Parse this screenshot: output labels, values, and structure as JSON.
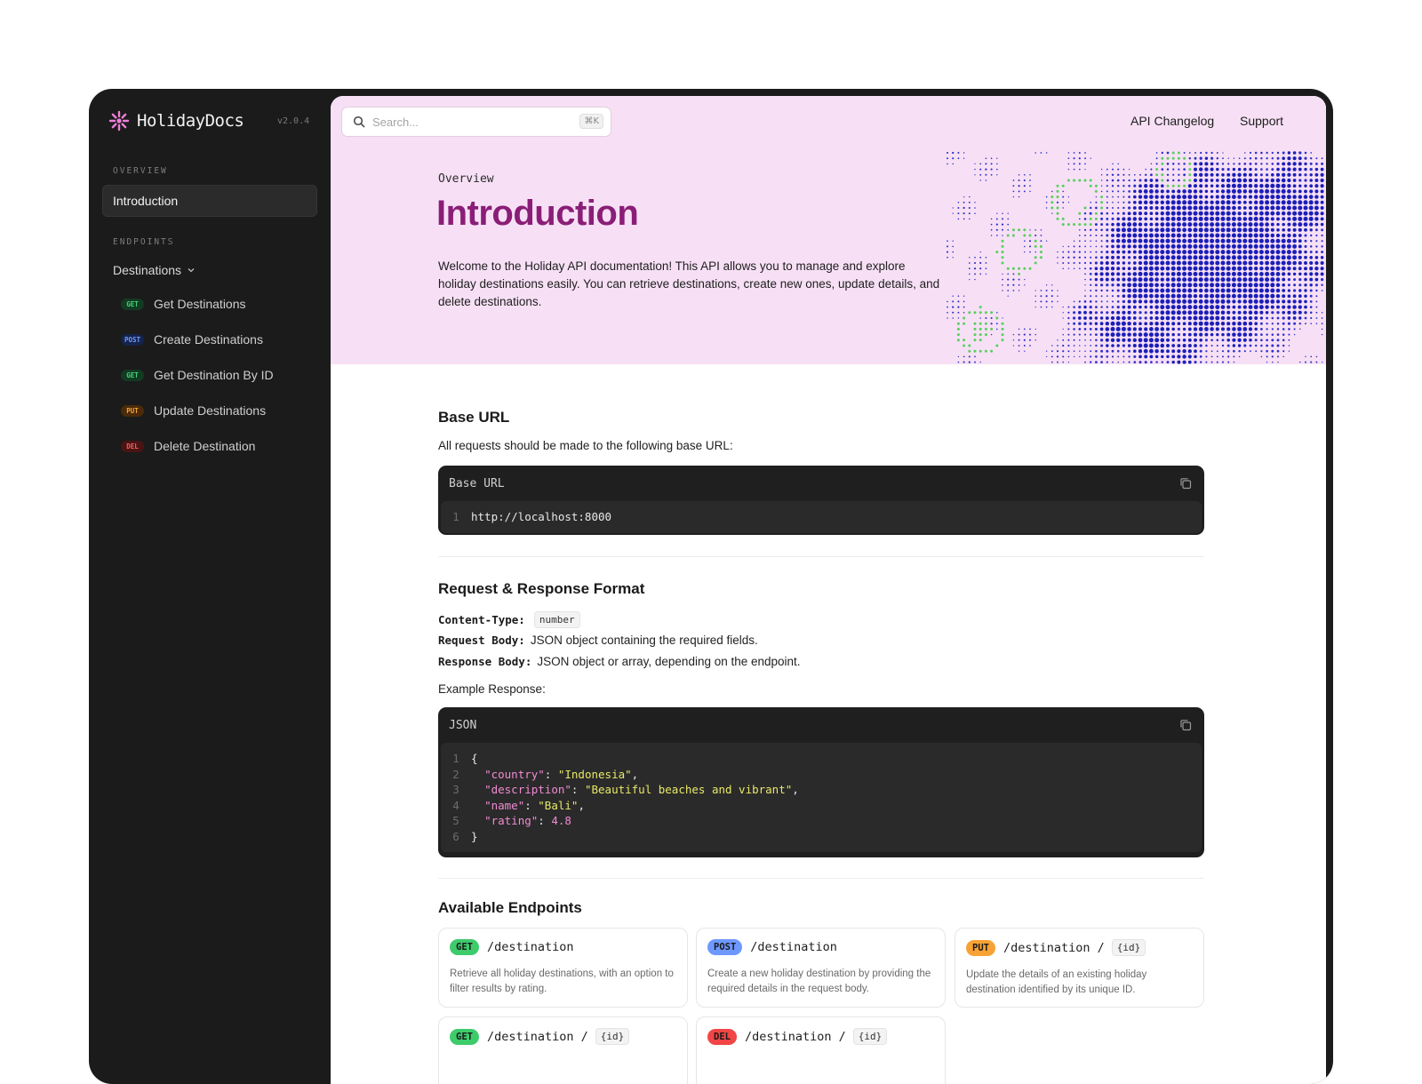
{
  "brand": {
    "name": "HolidayDocs",
    "version": "v2.0.4"
  },
  "sidebar": {
    "overview_label": "OVERVIEW",
    "intro_label": "Introduction",
    "endpoints_label": "ENDPOINTS",
    "group_label": "Destinations",
    "items": [
      {
        "method": "GET",
        "label": "Get Destinations"
      },
      {
        "method": "POST",
        "label": "Create Destinations"
      },
      {
        "method": "GET",
        "label": "Get Destination By ID"
      },
      {
        "method": "PUT",
        "label": "Update Destinations"
      },
      {
        "method": "DEL",
        "label": "Delete Destination"
      }
    ]
  },
  "search": {
    "placeholder": "Search...",
    "shortcut": "⌘K"
  },
  "topnav": {
    "changelog": "API Changelog",
    "support": "Support"
  },
  "hero": {
    "eyebrow": "Overview",
    "title": "Introduction",
    "description": "Welcome to the Holiday API documentation! This API allows you to manage and explore holiday destinations easily. You can retrieve destinations, create new ones, update details, and delete destinations."
  },
  "base_url": {
    "heading": "Base URL",
    "text": "All requests should be made to the following base URL:",
    "code_title": "Base URL",
    "line_no": "1",
    "url": "http://localhost:8000"
  },
  "format": {
    "heading": "Request & Response Format",
    "content_type_key": "Content-Type:",
    "content_type_value": "number",
    "request_key": "Request Body:",
    "request_value": "JSON object containing the required fields.",
    "response_key": "Response Body:",
    "response_value": "JSON object or array, depending on the endpoint.",
    "example_label": "Example Response:",
    "code_title": "JSON",
    "lines": {
      "l1": "{",
      "k2": "\"country\"",
      "v2": "\"Indonesia\"",
      "k3": "\"description\"",
      "v3": "\"Beautiful beaches and vibrant\"",
      "k4": "\"name\"",
      "v4": "\"Bali\"",
      "k5": "\"rating\"",
      "v5": "4.8",
      "l6": "}"
    },
    "line_numbers": [
      "1",
      "2",
      "3",
      "4",
      "5",
      "6"
    ]
  },
  "endpoints": {
    "heading": "Available Endpoints",
    "cards": [
      {
        "method": "GET",
        "path": "/destination",
        "param": "",
        "desc": "Retrieve all holiday destinations, with an option to filter results by rating."
      },
      {
        "method": "POST",
        "path": "/destination",
        "param": "",
        "desc": "Create a new holiday destination by providing the required details in the request body."
      },
      {
        "method": "PUT",
        "path": "/destination /",
        "param": "{id}",
        "desc": "Update the details of an existing holiday destination identified by its unique ID."
      },
      {
        "method": "GET",
        "path": "/destination /",
        "param": "{id}",
        "desc": ""
      },
      {
        "method": "DEL",
        "path": "/destination /",
        "param": "{id}",
        "desc": ""
      }
    ]
  },
  "colors": {
    "accent": "#8a1e77",
    "hero_bg": "#f7e0f5",
    "get": "#3ecb6c",
    "post": "#6f98ff",
    "put": "#f8a233",
    "del": "#f24545"
  },
  "icons": {
    "logo": "sunburst-logo-icon",
    "search": "search-icon",
    "copy": "copy-icon",
    "chevron": "chevron-down-icon"
  }
}
